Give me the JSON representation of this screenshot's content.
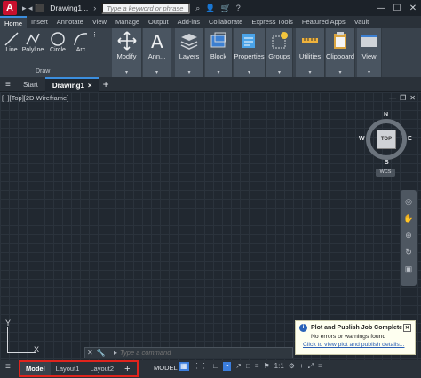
{
  "titlebar": {
    "app_icon": "A",
    "doc_title": "Drawing1...",
    "search_placeholder": "Type a keyword or phrase",
    "window_controls": [
      "—",
      "☐",
      "✕"
    ]
  },
  "ribbon_tabs": [
    "Home",
    "Insert",
    "Annotate",
    "View",
    "Manage",
    "Output",
    "Add-ins",
    "Collaborate",
    "Express Tools",
    "Featured Apps",
    "Vault"
  ],
  "draw_panel": {
    "tools": [
      "Line",
      "Polyline",
      "Circle",
      "Arc"
    ],
    "label": "Draw"
  },
  "ribbon_buttons": [
    "Modify",
    "Ann...",
    "Layers",
    "Block",
    "Properties",
    "Groups",
    "Utilities",
    "Clipboard",
    "View"
  ],
  "file_tabs": {
    "start": "Start",
    "drawing": "Drawing1"
  },
  "viewport": {
    "label": "[−][Top][2D Wireframe]",
    "viewcube": {
      "top": "TOP",
      "n": "N",
      "s": "S",
      "e": "E",
      "w": "W",
      "wcs": "WCS"
    },
    "ucs_x": "X",
    "ucs_y": "Y"
  },
  "command_line": {
    "placeholder": "Type a command"
  },
  "notification": {
    "title": "Plot and Publish Job Complete",
    "message": "No errors or warnings found",
    "link": "Click to view plot and publish details..."
  },
  "status_bar": {
    "layout_tabs": [
      "Model",
      "Layout1",
      "Layout2"
    ],
    "model_label": "MODEL",
    "scale": "1:1"
  }
}
